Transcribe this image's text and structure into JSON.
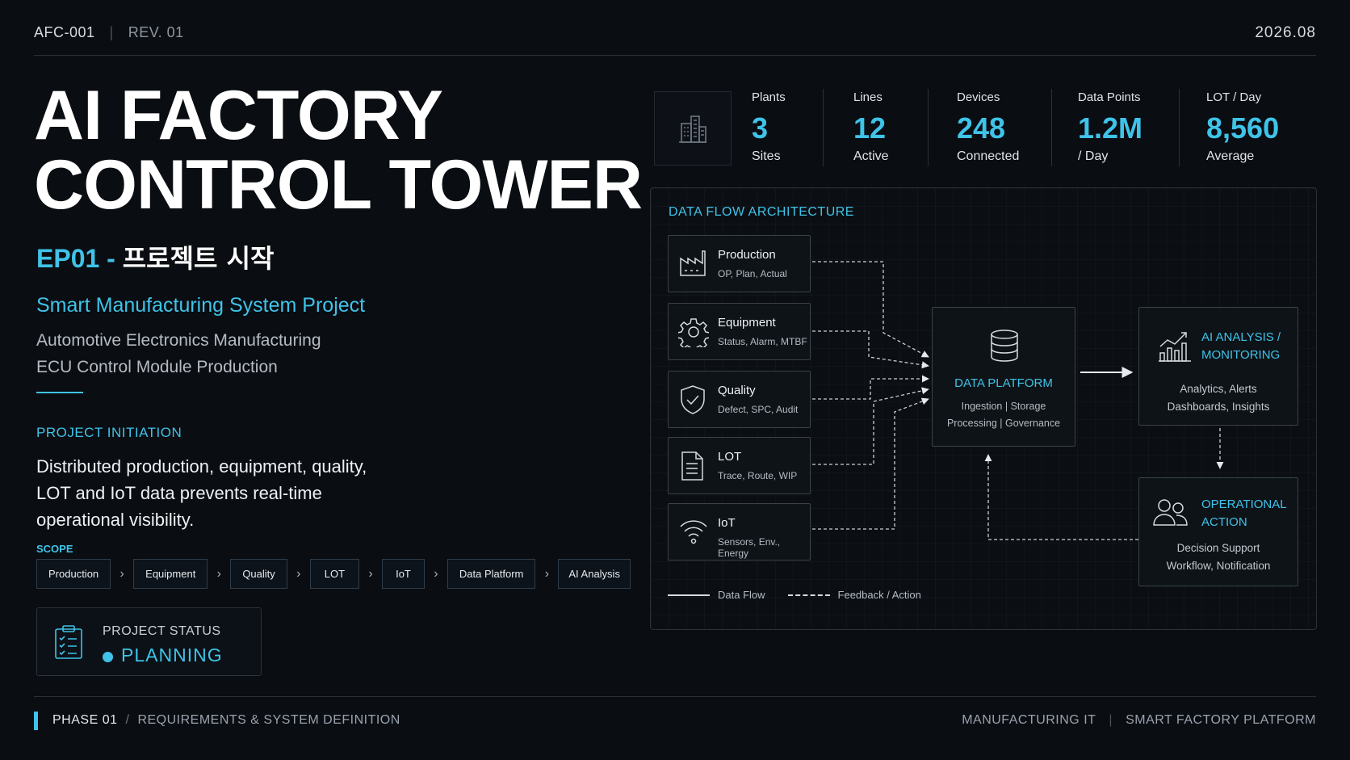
{
  "header": {
    "doc_id": "AFC-001",
    "rev": "REV. 01",
    "date": "2026.08"
  },
  "hero": {
    "title_line1": "AI FACTORY",
    "title_line2": "CONTROL TOWER",
    "ep_code": "EP01 - ",
    "ep_korean": "프로젝트 시작",
    "project_name": "Smart Manufacturing System Project",
    "desc_line1": "Automotive Electronics Manufacturing",
    "desc_line2": "ECU Control Module Production"
  },
  "initiation": {
    "label": "PROJECT INITIATION",
    "line1": "Distributed production, equipment, quality,",
    "line2": "LOT and IoT data prevents real-time",
    "line3": "operational visibility."
  },
  "scope": {
    "label": "SCOPE",
    "items": [
      "Production",
      "Equipment",
      "Quality",
      "LOT",
      "IoT",
      "Data Platform",
      "AI Analysis"
    ]
  },
  "status": {
    "label": "PROJECT STATUS",
    "value": "PLANNING"
  },
  "stats": [
    {
      "key": "Plants",
      "value": "3",
      "unit": "Sites"
    },
    {
      "key": "Lines",
      "value": "12",
      "unit": "Active"
    },
    {
      "key": "Devices",
      "value": "248",
      "unit": "Connected"
    },
    {
      "key": "Data Points",
      "value": "1.2M",
      "unit": "/ Day"
    },
    {
      "key": "LOT / Day",
      "value": "8,560",
      "unit": "Average"
    }
  ],
  "architecture": {
    "title": "DATA FLOW ARCHITECTURE",
    "sources": [
      {
        "name": "Production",
        "desc": "OP, Plan, Actual",
        "icon": "factory-icon"
      },
      {
        "name": "Equipment",
        "desc": "Status, Alarm, MTBF",
        "icon": "gear-icon"
      },
      {
        "name": "Quality",
        "desc": "Defect, SPC, Audit",
        "icon": "shield-check-icon"
      },
      {
        "name": "LOT",
        "desc": "Trace, Route, WIP",
        "icon": "document-icon"
      },
      {
        "name": "IoT",
        "desc": "Sensors, Env., Energy",
        "icon": "wifi-icon"
      }
    ],
    "platform": {
      "title": "DATA PLATFORM",
      "line1": "Ingestion  |  Storage",
      "line2": "Processing  |  Governance"
    },
    "ai": {
      "title_line1": "AI ANALYSIS /",
      "title_line2": "MONITORING",
      "desc_line1": "Analytics, Alerts",
      "desc_line2": "Dashboards, Insights"
    },
    "action": {
      "title_line1": "OPERATIONAL",
      "title_line2": "ACTION",
      "desc_line1": "Decision Support",
      "desc_line2": "Workflow, Notification"
    },
    "legend": {
      "solid": "Data Flow",
      "dashed": "Feedback / Action"
    }
  },
  "footer": {
    "phase": "PHASE 01",
    "phase_desc": "REQUIREMENTS & SYSTEM DEFINITION",
    "right1": "MANUFACTURING IT",
    "right2": "SMART FACTORY PLATFORM"
  },
  "colors": {
    "accent": "#3fc3e8",
    "background": "#0a0d12"
  }
}
